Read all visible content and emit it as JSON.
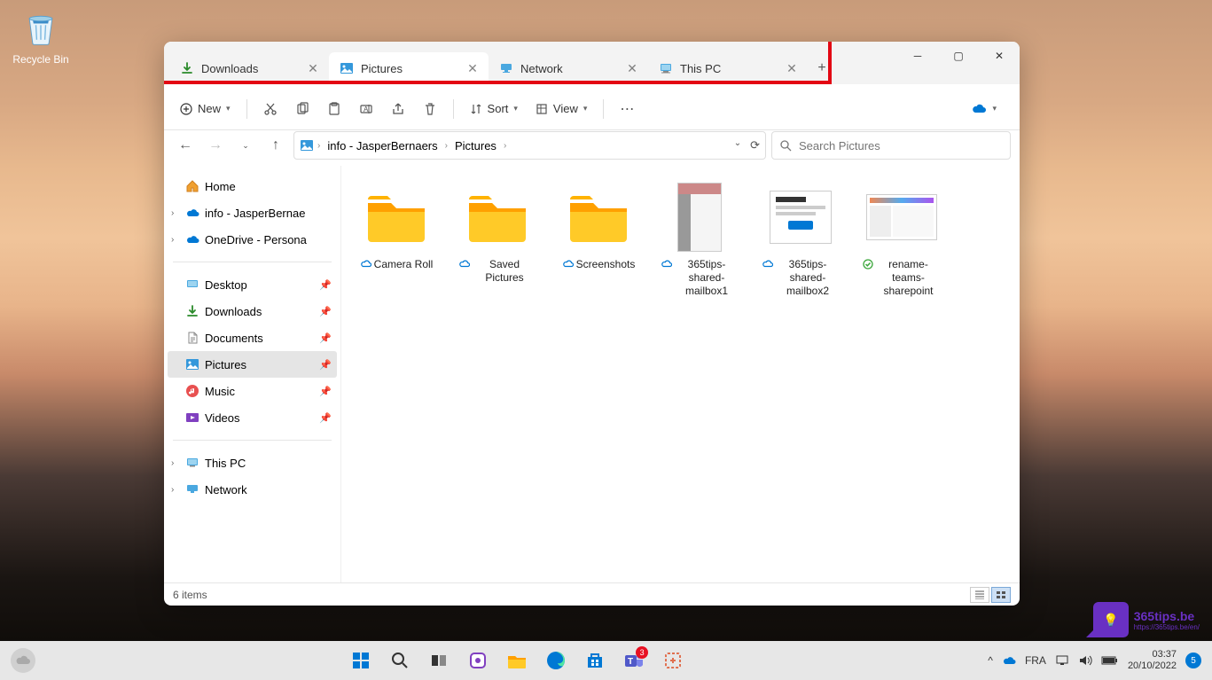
{
  "desktop": {
    "recycle_bin": "Recycle Bin"
  },
  "window": {
    "tabs": [
      {
        "label": "Downloads",
        "active": false,
        "icon": "downloads"
      },
      {
        "label": "Pictures",
        "active": true,
        "icon": "pictures"
      },
      {
        "label": "Network",
        "active": false,
        "icon": "network"
      },
      {
        "label": "This PC",
        "active": false,
        "icon": "thispc"
      }
    ],
    "toolbar": {
      "new": "New",
      "sort": "Sort",
      "view": "View"
    },
    "breadcrumb": [
      "info - JasperBernaers",
      "Pictures"
    ],
    "search_placeholder": "Search Pictures",
    "sidebar": {
      "top": [
        {
          "label": "Home",
          "icon": "home"
        },
        {
          "label": "info - JasperBernae",
          "icon": "onedrive",
          "expandable": true
        },
        {
          "label": "OneDrive - Persona",
          "icon": "onedrive",
          "expandable": true
        }
      ],
      "quick": [
        {
          "label": "Desktop",
          "icon": "desktop",
          "pinned": true
        },
        {
          "label": "Downloads",
          "icon": "downloads",
          "pinned": true
        },
        {
          "label": "Documents",
          "icon": "documents",
          "pinned": true
        },
        {
          "label": "Pictures",
          "icon": "pictures",
          "pinned": true,
          "selected": true
        },
        {
          "label": "Music",
          "icon": "music",
          "pinned": true
        },
        {
          "label": "Videos",
          "icon": "videos",
          "pinned": true
        }
      ],
      "bottom": [
        {
          "label": "This PC",
          "icon": "thispc",
          "expandable": true
        },
        {
          "label": "Network",
          "icon": "network",
          "expandable": true
        }
      ]
    },
    "files": [
      {
        "name": "Camera Roll",
        "type": "folder",
        "sync": "cloud"
      },
      {
        "name": "Saved Pictures",
        "type": "folder",
        "sync": "cloud"
      },
      {
        "name": "Screenshots",
        "type": "folder",
        "sync": "cloud"
      },
      {
        "name": "365tips-shared-mailbox1",
        "type": "image",
        "sync": "cloud"
      },
      {
        "name": "365tips-shared-mailbox2",
        "type": "image",
        "sync": "cloud"
      },
      {
        "name": "rename-teams-sharepoint",
        "type": "image",
        "sync": "available"
      }
    ],
    "status": "6 items"
  },
  "taskbar": {
    "lang": "FRA",
    "time": "03:37",
    "date": "20/10/2022",
    "notifications": "5",
    "teams_badge": "3"
  },
  "watermark": {
    "text": "365tips.be",
    "sub": "https://365tips.be/en/"
  }
}
